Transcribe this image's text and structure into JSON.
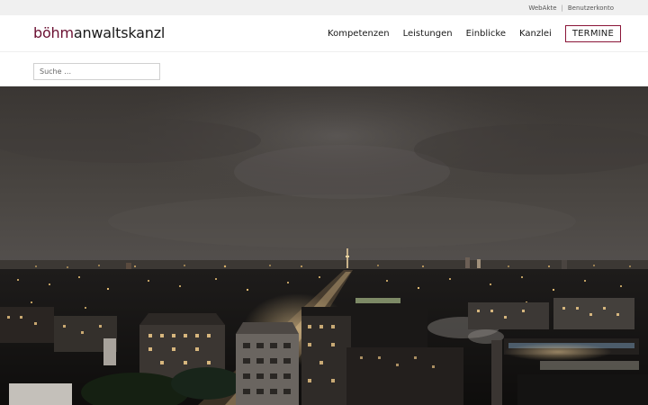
{
  "topbar": {
    "links": [
      {
        "label": "WebAkte"
      },
      {
        "label": "Benutzerkonto"
      }
    ],
    "separator": "|"
  },
  "header": {
    "logo": {
      "accent": "böhm",
      "rest": "anwaltskanzlei"
    },
    "nav": [
      {
        "label": "Kompetenzen"
      },
      {
        "label": "Leistungen"
      },
      {
        "label": "Einblicke"
      },
      {
        "label": "Kanzlei"
      }
    ],
    "cta_label": "TERMINE"
  },
  "search": {
    "placeholder": "Suche …"
  },
  "colors": {
    "brand": "#6b1032",
    "cta_border": "#8a1538",
    "topbar_bg": "#f0f0f0"
  }
}
